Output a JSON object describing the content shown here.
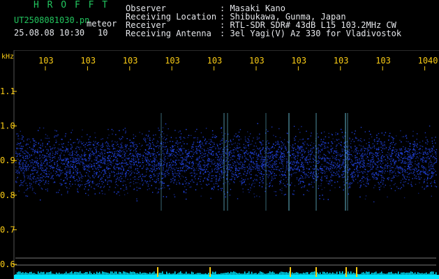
{
  "header": {
    "app_name": "H R O F F T",
    "filename": "UT2508081030.pn",
    "mode": "meteor",
    "datetime": "25.08.08 10:30",
    "datetime_suffix": "10",
    "fields": [
      {
        "label": "Observer",
        "value": ": Masaki Kano"
      },
      {
        "label": "Receiving Location",
        "value": ": Shibukawa, Gunma, Japan"
      },
      {
        "label": "Receiver",
        "value": ": RTL-SDR SDR# 43dB L15 103.2MHz CW"
      },
      {
        "label": "Receiving Antenna",
        "value": ": 3el Yagi(V) Az 330 for Vladivostok"
      }
    ]
  },
  "axes": {
    "unit_label": "kHz",
    "x_ticks": [
      "103",
      "103",
      "103",
      "103",
      "103",
      "103",
      "103",
      "103",
      "103",
      "1040"
    ],
    "y_ticks": [
      "1.1",
      "1.0",
      "0.9",
      "0.8",
      "0.7",
      "0.6"
    ]
  },
  "colors": {
    "background": "#000000",
    "signal": "#1e3cff",
    "bright": "#7fe6ff",
    "axis_text": "#facc15",
    "title": "#22c55e",
    "cyan_band": "#00e5ff"
  }
}
